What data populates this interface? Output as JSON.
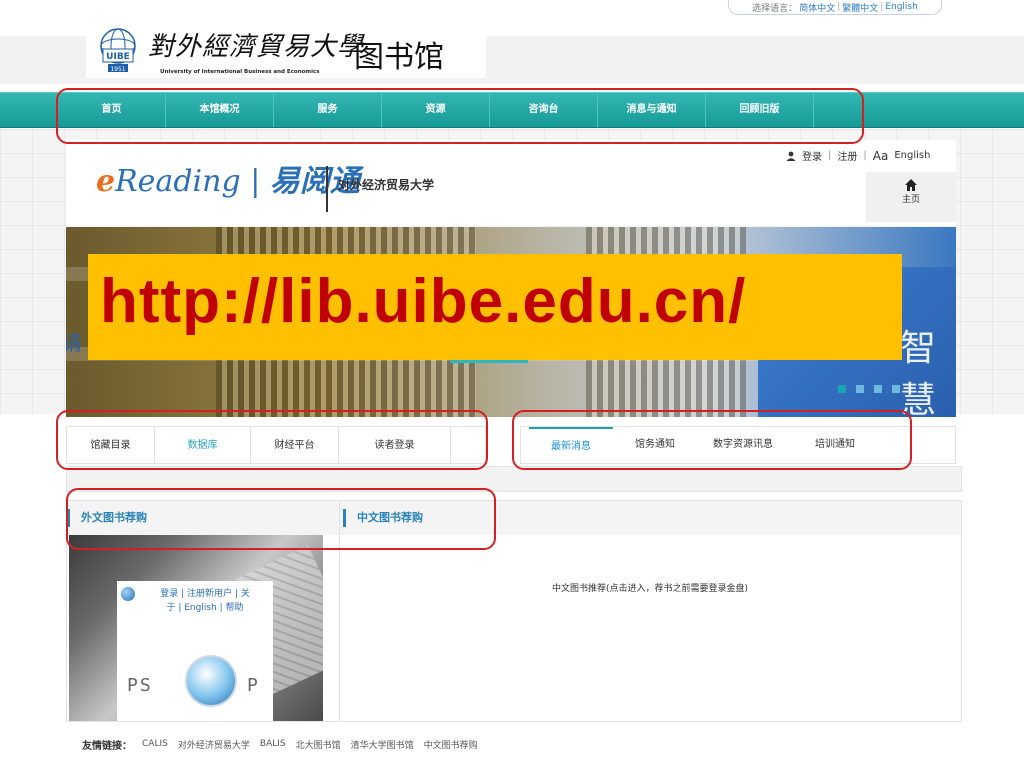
{
  "lang_bar": {
    "label": "选择语言：",
    "options": [
      "简体中文",
      "繁體中文",
      "English"
    ]
  },
  "header": {
    "emblem_year": "1951",
    "emblem_text": "UIBE",
    "calligraphy": "對外經濟貿易大學",
    "university_en": "University of International Business and Economics",
    "library_name": "图书馆"
  },
  "nav": {
    "items": [
      "首页",
      "本馆概况",
      "服务",
      "资源",
      "咨询台",
      "消息与通知",
      "回顾旧版"
    ]
  },
  "ereading": {
    "logo_prefix": "e",
    "logo_mid": "Reading",
    "logo_cn": "易阅通",
    "university_cn": "对外经济贸易大学",
    "login": "登录",
    "register": "注册",
    "english": "English",
    "font_glyph": "Aa",
    "home": "主页"
  },
  "banner": {
    "url": "http://lib.uibe.edu.cn/",
    "left_char": "请",
    "right_chars": "智慧"
  },
  "search_tabs": [
    "馆藏目录",
    "数据库",
    "财经平台",
    "读者登录"
  ],
  "news_tabs": [
    "最新消息",
    "馆务通知",
    "数字资源讯息",
    "培训通知"
  ],
  "sections": {
    "foreign": "外文图书荐购",
    "chinese": "中文图书荐购",
    "chinese_note": "中文图书推荐(点击进入，荐书之前需要登录金盘)"
  },
  "pso": {
    "links_line1": "登录 | 注册新用户 | 关",
    "links_line2": "于 | English | 帮助",
    "ps": "PS",
    "p": "P"
  },
  "footer": {
    "label": "友情链接：",
    "links": [
      "CALIS",
      "对外经济贸易大学",
      "BALIS",
      "北大图书馆",
      "清华大学图书馆",
      "中文图书荐购"
    ]
  },
  "colors": {
    "nav_teal": "#1aa19d",
    "url_yellow": "#ffc000",
    "url_red": "#c00000",
    "annotation_red": "#d42020",
    "accent_blue": "#2b84b8"
  }
}
